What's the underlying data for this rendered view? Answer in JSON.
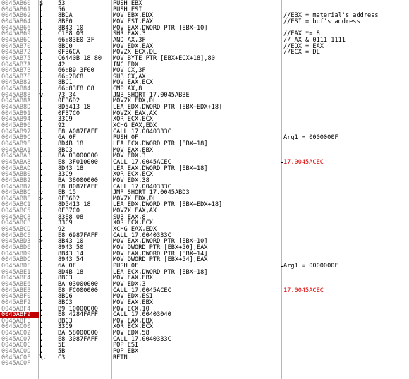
{
  "rows": [
    {
      "addr": "0045AB60",
      "flow": "$",
      "hex": "53",
      "asm": "PUSH EBX",
      "cmt": ""
    },
    {
      "addr": "0045AB61",
      "flow": ".",
      "hex": "56",
      "asm": "PUSH ESI",
      "cmt": ""
    },
    {
      "addr": "0045AB62",
      "flow": ".",
      "hex": "8BDA",
      "asm": "MOV EBX,EDX",
      "cmt": "//EBX = material's address"
    },
    {
      "addr": "0045AB64",
      "flow": ".",
      "hex": "8BF0",
      "asm": "MOV ESI,EAX",
      "cmt": "//ESI = buf's address"
    },
    {
      "addr": "0045AB66",
      "flow": ".",
      "hex": "8B43 10",
      "asm": "MOV EAX,DWORD PTR [EBX+10]",
      "cmt": ""
    },
    {
      "addr": "0045AB69",
      "flow": ".",
      "hex": "C1E8 03",
      "asm": "SHR EAX,3",
      "cmt": "//EAX *= 8"
    },
    {
      "addr": "0045AB6C",
      "flow": ".",
      "hex": "66:83E0 3F",
      "asm": "AND AX,3F",
      "cmt": "// AX & 0111 1111"
    },
    {
      "addr": "0045AB70",
      "flow": ".",
      "hex": "8BD0",
      "asm": "MOV EDX,EAX",
      "cmt": "//EDX = EAX"
    },
    {
      "addr": "0045AB72",
      "flow": ".",
      "hex": "0FB6CA",
      "asm": "MOVZX ECX,DL",
      "cmt": "//ECX = DL"
    },
    {
      "addr": "0045AB75",
      "flow": ".",
      "hex": "C6440B 18 80",
      "asm": "MOV BYTE PTR [EBX+ECX+18],80",
      "cmt": ""
    },
    {
      "addr": "0045AB7A",
      "flow": ".",
      "hex": "42",
      "asm": "INC EDX",
      "cmt": ""
    },
    {
      "addr": "0045AB7B",
      "flow": ".",
      "hex": "66:B9 3F00",
      "asm": "MOV CX,3F",
      "cmt": ""
    },
    {
      "addr": "0045AB7F",
      "flow": ".",
      "hex": "66:2BC8",
      "asm": "SUB CX,AX",
      "cmt": ""
    },
    {
      "addr": "0045AB82",
      "flow": ".",
      "hex": "8BC1",
      "asm": "MOV EAX,ECX",
      "cmt": ""
    },
    {
      "addr": "0045AB84",
      "flow": ".",
      "hex": "66:83F8 08",
      "asm": "CMP AX,8",
      "cmt": ""
    },
    {
      "addr": "0045AB88",
      "flow": "v",
      "hex": "73 34",
      "asm": "JNB SHORT 17.0045ABBE",
      "cmt": ""
    },
    {
      "addr": "0045AB8A",
      "flow": ".",
      "hex": "0FB6D2",
      "asm": "MOVZX EDX,DL",
      "cmt": ""
    },
    {
      "addr": "0045AB8D",
      "flow": ".",
      "hex": "8D5413 18",
      "asm": "LEA EDX,DWORD PTR [EBX+EDX+18]",
      "cmt": ""
    },
    {
      "addr": "0045AB91",
      "flow": ".",
      "hex": "0FB7C0",
      "asm": "MOVZX EAX,AX",
      "cmt": ""
    },
    {
      "addr": "0045AB94",
      "flow": ".",
      "hex": "33C9",
      "asm": "XOR ECX,ECX",
      "cmt": ""
    },
    {
      "addr": "0045AB96",
      "flow": ".",
      "hex": "92",
      "asm": "XCHG EAX,EDX",
      "cmt": ""
    },
    {
      "addr": "0045AB97",
      "flow": ".",
      "hex": "E8 A087FAFF",
      "asm": "CALL 17.0040333C",
      "cmt": ""
    },
    {
      "addr": "0045AB9C",
      "flow": ".",
      "hex": "6A 0F",
      "asm": "PUSH 0F",
      "cmt": "Arg1 = 0000000F",
      "bracket": "start"
    },
    {
      "addr": "0045AB9E",
      "flow": ".",
      "hex": "8D4B 18",
      "asm": "LEA ECX,DWORD PTR [EBX+18]",
      "cmt": "",
      "bracket": "mid"
    },
    {
      "addr": "0045ABA1",
      "flow": ".",
      "hex": "8BC3",
      "asm": "MOV EAX,EBX",
      "cmt": "",
      "bracket": "mid"
    },
    {
      "addr": "0045ABA3",
      "flow": ".",
      "hex": "BA 03000000",
      "asm": "MOV EDX,3",
      "cmt": "",
      "bracket": "mid"
    },
    {
      "addr": "0045ABA8",
      "flow": ".",
      "hex": "E8 3F010000",
      "asm": "CALL 17.0045ACEC",
      "cmt": "17.0045ACEC",
      "red": true,
      "bracket": "end"
    },
    {
      "addr": "0045ABAD",
      "flow": ".",
      "hex": "8D43 18",
      "asm": "LEA EAX,DWORD PTR [EBX+18]",
      "cmt": ""
    },
    {
      "addr": "0045ABB0",
      "flow": ".",
      "hex": "33C9",
      "asm": "XOR ECX,ECX",
      "cmt": ""
    },
    {
      "addr": "0045ABB2",
      "flow": ".",
      "hex": "BA 38000000",
      "asm": "MOV EDX,38",
      "cmt": ""
    },
    {
      "addr": "0045ABB7",
      "flow": ".",
      "hex": "E8 8087FAFF",
      "asm": "CALL 17.0040333C",
      "cmt": ""
    },
    {
      "addr": "0045ABBC",
      "flow": "v",
      "hex": "EB 15",
      "asm": "JMP SHORT 17.0045ABD3",
      "cmt": ""
    },
    {
      "addr": "0045ABBE",
      "flow": ">",
      "hex": "0FB6D2",
      "asm": "MOVZX EDX,DL",
      "cmt": ""
    },
    {
      "addr": "0045ABC1",
      "flow": ".",
      "hex": "8D5413 18",
      "asm": "LEA EDX,DWORD PTR [EBX+EDX+18]",
      "cmt": ""
    },
    {
      "addr": "0045ABC5",
      "flow": ".",
      "hex": "0FB7C0",
      "asm": "MOVZX EAX,AX",
      "cmt": ""
    },
    {
      "addr": "0045ABC8",
      "flow": ".",
      "hex": "83E8 08",
      "asm": "SUB EAX,8",
      "cmt": ""
    },
    {
      "addr": "0045ABCB",
      "flow": ".",
      "hex": "33C9",
      "asm": "XOR ECX,ECX",
      "cmt": ""
    },
    {
      "addr": "0045ABCD",
      "flow": ".",
      "hex": "92",
      "asm": "XCHG EAX,EDX",
      "cmt": ""
    },
    {
      "addr": "0045ABCE",
      "flow": ".",
      "hex": "E8 6987FAFF",
      "asm": "CALL 17.0040333C",
      "cmt": ""
    },
    {
      "addr": "0045ABD3",
      "flow": ">",
      "hex": "8B43 10",
      "asm": "MOV EAX,DWORD PTR [EBX+10]",
      "cmt": ""
    },
    {
      "addr": "0045ABD6",
      "flow": ".",
      "hex": "8943 50",
      "asm": "MOV DWORD PTR [EBX+50],EAX",
      "cmt": ""
    },
    {
      "addr": "0045ABD9",
      "flow": ".",
      "hex": "8B43 14",
      "asm": "MOV EAX,DWORD PTR [EBX+14]",
      "cmt": ""
    },
    {
      "addr": "0045ABDC",
      "flow": ".",
      "hex": "8943 54",
      "asm": "MOV DWORD PTR [EBX+54],EAX",
      "cmt": ""
    },
    {
      "addr": "0045ABDF",
      "flow": ".",
      "hex": "6A 0F",
      "asm": "PUSH 0F",
      "cmt": "Arg1 = 0000000F",
      "bracket": "start"
    },
    {
      "addr": "0045ABE1",
      "flow": ".",
      "hex": "8D4B 18",
      "asm": "LEA ECX,DWORD PTR [EBX+18]",
      "cmt": "",
      "bracket": "mid"
    },
    {
      "addr": "0045ABE4",
      "flow": ".",
      "hex": "8BC3",
      "asm": "MOV EAX,EBX",
      "cmt": "",
      "bracket": "mid"
    },
    {
      "addr": "0045ABE6",
      "flow": ".",
      "hex": "BA 03000000",
      "asm": "MOV EDX,3",
      "cmt": "",
      "bracket": "mid"
    },
    {
      "addr": "0045ABEB",
      "flow": ".",
      "hex": "E8 FC000000",
      "asm": "CALL 17.0045ACEC",
      "cmt": "17.0045ACEC",
      "red": true,
      "bracket": "end"
    },
    {
      "addr": "0045ABF0",
      "flow": ".",
      "hex": "8BD6",
      "asm": "MOV EDX,ESI",
      "cmt": ""
    },
    {
      "addr": "0045ABF2",
      "flow": ".",
      "hex": "8BC3",
      "asm": "MOV EAX,EBX",
      "cmt": ""
    },
    {
      "addr": "0045ABF4",
      "flow": ".",
      "hex": "B9 10000000",
      "asm": "MOV ECX,10",
      "cmt": ""
    },
    {
      "addr": "0045ABF9",
      "flow": ".",
      "hex": "E8 4284FAFF",
      "asm": "CALL 17.00403040",
      "cmt": "",
      "selected": true
    },
    {
      "addr": "0045ABFE",
      "flow": ".",
      "hex": "8BC3",
      "asm": "MOV EAX,EBX",
      "cmt": ""
    },
    {
      "addr": "0045AC00",
      "flow": ".",
      "hex": "33C9",
      "asm": "XOR ECX,ECX",
      "cmt": ""
    },
    {
      "addr": "0045AC02",
      "flow": ".",
      "hex": "BA 58000000",
      "asm": "MOV EDX,58",
      "cmt": ""
    },
    {
      "addr": "0045AC07",
      "flow": ".",
      "hex": "E8 3087FAFF",
      "asm": "CALL 17.0040333C",
      "cmt": ""
    },
    {
      "addr": "0045AC0C",
      "flow": ".",
      "hex": "5E",
      "asm": "POP ESI",
      "cmt": ""
    },
    {
      "addr": "0045AC0D",
      "flow": ".",
      "hex": "5B",
      "asm": "POP EBX",
      "cmt": ""
    },
    {
      "addr": "0045AC0E",
      "flow": "\\.",
      "hex": "C3",
      "asm": "RETN",
      "cmt": ""
    },
    {
      "addr": "0045AC0F",
      "flow": "",
      "hex": "",
      "asm": "",
      "cmt": ""
    }
  ]
}
